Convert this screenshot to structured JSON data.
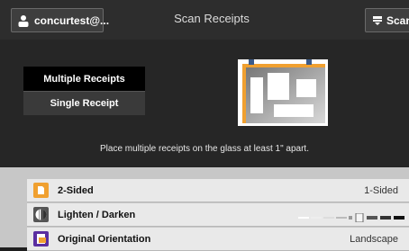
{
  "topbar": {
    "user_label": "concurtest@...",
    "title": "Scan Receipts",
    "scan_label": "Scan"
  },
  "modes": {
    "multiple_label": "Multiple Receipts",
    "single_label": "Single Receipt",
    "selected": "Multiple Receipts"
  },
  "hint": "Place multiple receipts on the glass at least 1\" apart.",
  "settings": [
    {
      "label": "2-Sided",
      "value": "1-Sided",
      "icon": "two-sided-icon"
    },
    {
      "label": "Lighten / Darken",
      "value": "",
      "icon": "lighten-darken-icon",
      "level": 0.5
    },
    {
      "label": "Original Orientation",
      "value": "Landscape",
      "icon": "orientation-icon"
    }
  ],
  "colors": {
    "accent_orange": "#f0a030",
    "purple": "#5a2ea0",
    "dark_bg": "#262626"
  }
}
